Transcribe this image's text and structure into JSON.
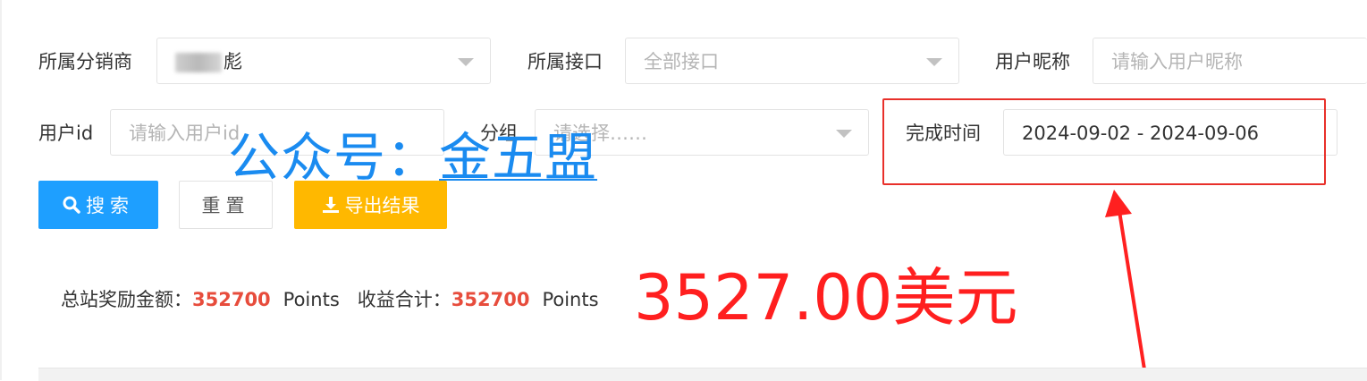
{
  "filters": {
    "distributor": {
      "label": "所属分销商",
      "value": "彪"
    },
    "interface": {
      "label": "所属接口",
      "value": "全部接口"
    },
    "nickname": {
      "label": "用户昵称",
      "placeholder": "请输入用户昵称"
    },
    "user_id": {
      "label": "用户id",
      "placeholder": "请输入用户id"
    },
    "group": {
      "label": "分组",
      "placeholder": "请选择……"
    },
    "completion_time": {
      "label": "完成时间",
      "value": "2024-09-02 - 2024-09-06"
    }
  },
  "buttons": {
    "search": "搜索",
    "reset": "重置",
    "export": "导出结果"
  },
  "stats": {
    "total_reward_label": "总站奖励金额：",
    "total_reward_value": "352700",
    "total_reward_unit": "Points",
    "income_label": "收益合计：",
    "income_value": "352700",
    "income_unit": "Points"
  },
  "annotations": {
    "watermark_prefix": "公众号：",
    "watermark_brand": "金五盟",
    "usd_amount": "3527.00美元",
    "highlight_color": "#e8302a",
    "watermark_color": "#1a8bf0"
  },
  "icons": {
    "search": "search-icon",
    "export": "download-icon",
    "dropdown": "chevron-down-icon"
  },
  "colors": {
    "primary": "#1e9fff",
    "warning": "#ffb800",
    "stat_number": "#e74c3c"
  }
}
